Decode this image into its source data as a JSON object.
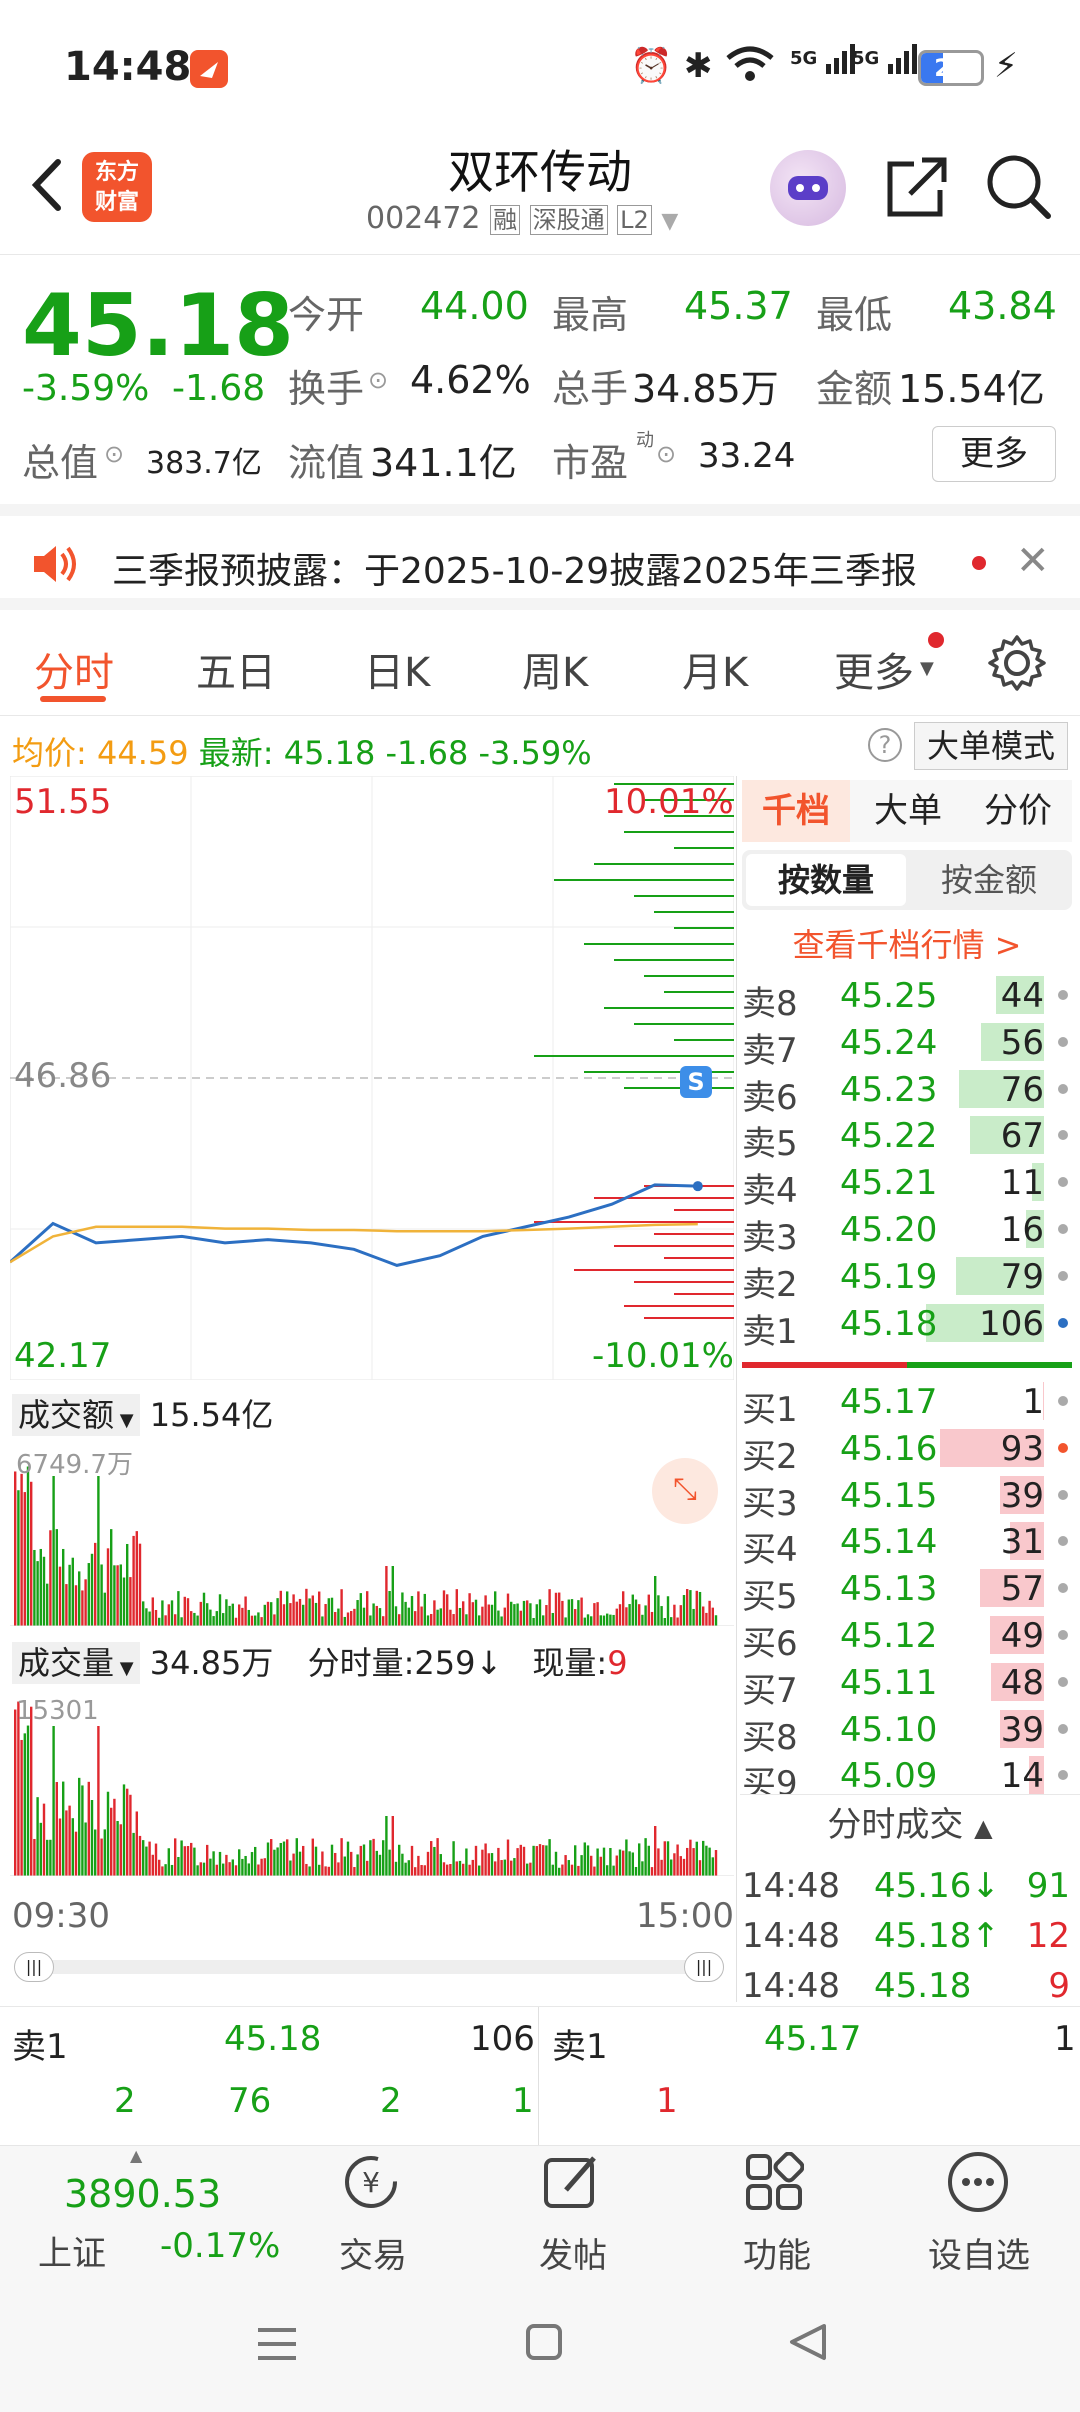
{
  "status": {
    "time": "14:48",
    "battery": "21",
    "net1": "5G",
    "net2": "5G"
  },
  "header": {
    "title": "双环传动",
    "code": "002472",
    "tags": [
      "融",
      "深股通",
      "L2"
    ],
    "logo_line1": "东方",
    "logo_line2": "财富"
  },
  "quote": {
    "price": "45.18",
    "pct": "-3.59%",
    "chg": "-1.68",
    "open_label": "今开",
    "open": "44.00",
    "high_label": "最高",
    "high": "45.37",
    "low_label": "最低",
    "low": "43.84",
    "turnover_label": "换手",
    "turnover": "4.62%",
    "volume_label": "总手",
    "volume": "34.85万",
    "amount_label": "金额",
    "amount": "15.54亿",
    "mcap_label": "总值",
    "mcap": "383.7亿",
    "float_label": "流值",
    "float": "341.1亿",
    "pe_label": "市盈",
    "pe_sup": "动",
    "pe": "33.24",
    "more": "更多"
  },
  "notice": {
    "text": "三季报预披露：于2025-10-29披露2025年三季报"
  },
  "tabs": [
    {
      "label": "分时"
    },
    {
      "label": "五日"
    },
    {
      "label": "日K"
    },
    {
      "label": "周K"
    },
    {
      "label": "月K"
    },
    {
      "label": "更多"
    }
  ],
  "infoline": {
    "avg_label": "均价:",
    "avg": "44.59",
    "last_label": "最新:",
    "last": "45.18",
    "chg": "-1.68",
    "pct": "-3.59%",
    "mode_btn": "大单模式"
  },
  "chart": {
    "top_price": "51.55",
    "top_pct": "10.01%",
    "mid_price": "46.86",
    "bot_price": "42.17",
    "bot_pct": "-10.01%",
    "amount_label": "成交额",
    "amount": "15.54亿",
    "amount_max": "6749.7万",
    "vol_label": "成交量",
    "vol": "34.85万",
    "tick_label": "分时量:",
    "tick": "259↓",
    "now_label": "现量:",
    "now": "9",
    "vol_max": "15301",
    "time_start": "09:30",
    "time_end": "15:00"
  },
  "chart_data": {
    "type": "line",
    "title": "",
    "ylim": [
      42.17,
      51.55
    ],
    "ref_price": 46.86,
    "x": [
      "09:30",
      "09:45",
      "10:00",
      "10:15",
      "10:30",
      "10:45",
      "11:00",
      "11:15",
      "11:30",
      "13:15",
      "13:30",
      "13:45",
      "14:00",
      "14:15",
      "14:30",
      "14:45",
      "14:48"
    ],
    "series": [
      {
        "name": "最新",
        "values": [
          44.0,
          44.6,
          44.3,
          44.35,
          44.4,
          44.3,
          44.35,
          44.3,
          44.2,
          43.95,
          44.1,
          44.4,
          44.55,
          44.7,
          44.9,
          45.2,
          45.18
        ]
      },
      {
        "name": "均价",
        "values": [
          44.0,
          44.4,
          44.55,
          44.55,
          44.55,
          44.52,
          44.52,
          44.5,
          44.5,
          44.48,
          44.48,
          44.48,
          44.5,
          44.52,
          44.55,
          44.58,
          44.59
        ]
      }
    ]
  },
  "orderbook": {
    "tabs": [
      "千档",
      "大单",
      "分价"
    ],
    "subtabs": [
      "按数量",
      "按金额"
    ],
    "link": "查看千档行情 >",
    "asks": [
      {
        "label": "卖8",
        "price": "45.25",
        "qty": "44",
        "pct": 0.41
      },
      {
        "label": "卖7",
        "price": "45.24",
        "qty": "56",
        "pct": 0.53
      },
      {
        "label": "卖6",
        "price": "45.23",
        "qty": "76",
        "pct": 0.72
      },
      {
        "label": "卖5",
        "price": "45.22",
        "qty": "67",
        "pct": 0.63
      },
      {
        "label": "卖4",
        "price": "45.21",
        "qty": "11",
        "pct": 0.1
      },
      {
        "label": "卖3",
        "price": "45.20",
        "qty": "16",
        "pct": 0.15
      },
      {
        "label": "卖2",
        "price": "45.19",
        "qty": "79",
        "pct": 0.75
      },
      {
        "label": "卖1",
        "price": "45.18",
        "qty": "106",
        "pct": 1.0
      }
    ],
    "bids": [
      {
        "label": "买1",
        "price": "45.17",
        "qty": "1",
        "pct": 0.01
      },
      {
        "label": "买2",
        "price": "45.16",
        "qty": "93",
        "pct": 0.88
      },
      {
        "label": "买3",
        "price": "45.15",
        "qty": "39",
        "pct": 0.37
      },
      {
        "label": "买4",
        "price": "45.14",
        "qty": "31",
        "pct": 0.29
      },
      {
        "label": "买5",
        "price": "45.13",
        "qty": "57",
        "pct": 0.54
      },
      {
        "label": "买6",
        "price": "45.12",
        "qty": "49",
        "pct": 0.46
      },
      {
        "label": "买7",
        "price": "45.11",
        "qty": "48",
        "pct": 0.45
      },
      {
        "label": "买8",
        "price": "45.10",
        "qty": "39",
        "pct": 0.37
      },
      {
        "label": "买9",
        "price": "45.09",
        "qty": "14",
        "pct": 0.13
      }
    ]
  },
  "trades": {
    "title": "分时成交",
    "rows": [
      {
        "time": "14:48",
        "price": "45.16↓",
        "qty": "91"
      },
      {
        "time": "14:48",
        "price": "45.18↑",
        "qty": "12"
      },
      {
        "time": "14:48",
        "price": "45.18",
        "qty": "9"
      }
    ]
  },
  "queue": {
    "sell_label": "卖1",
    "sell_price": "45.18",
    "sell_qty": "106",
    "buy_label": "卖1",
    "buy_price": "45.17",
    "buy_qty": "1",
    "sell_items": [
      "2",
      "76",
      "2",
      "1"
    ],
    "buy_items": [
      "1"
    ]
  },
  "bottom": {
    "index": "3890.53",
    "index_name": "上证",
    "index_pct": "-0.17%",
    "items": [
      "交易",
      "发帖",
      "功能",
      "设自选"
    ]
  }
}
